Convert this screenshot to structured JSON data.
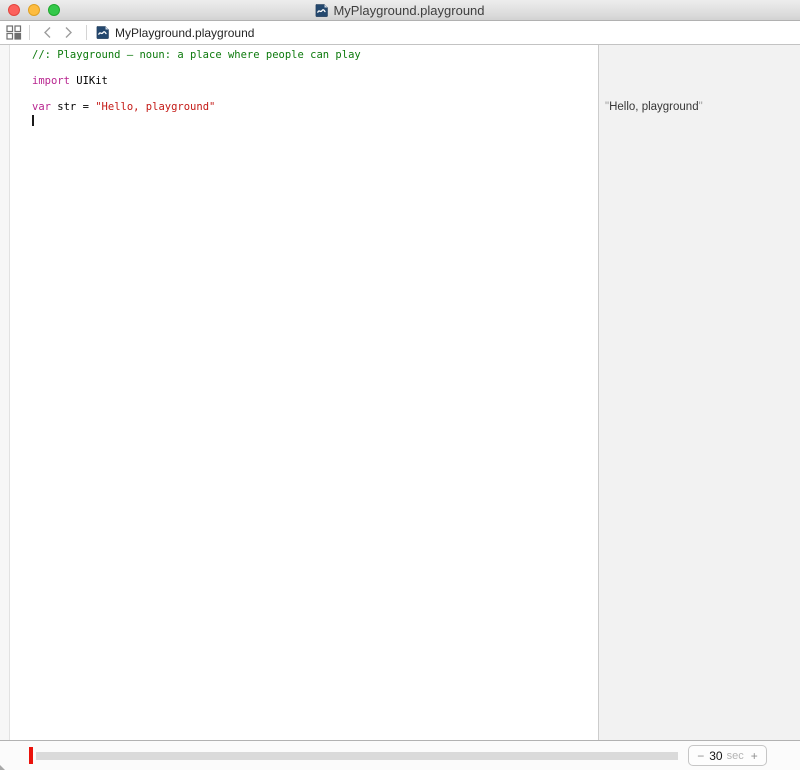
{
  "window": {
    "title": "MyPlayground.playground"
  },
  "icons": {
    "related_items": "grid-of-four-squares",
    "back": "chevron-left",
    "forward": "chevron-right",
    "file": "playground-document",
    "titlebar_file": "playground-document"
  },
  "jump_bar": {
    "file_label": "MyPlayground.playground"
  },
  "code": {
    "line1": {
      "comment": "//: Playground — noun: a place where people can play"
    },
    "line3": {
      "keyword": "import",
      "rest": " UIKit"
    },
    "line5": {
      "keyword": "var",
      "mid": " str = ",
      "string": "\"Hello, playground\""
    }
  },
  "results": {
    "item": {
      "open_quote": "\"",
      "text": "Hello, playground",
      "close_quote": "\""
    }
  },
  "bottom_bar": {
    "duration_control": {
      "minus": "−",
      "value": "30",
      "unit": "sec",
      "plus": "+"
    }
  },
  "colors": {
    "comment_green": "#0d7a0d",
    "keyword_pink": "#b8258f",
    "string_red": "#c41a16",
    "timeline_marker_red": "#ea120b",
    "results_background": "#f2f2f2"
  }
}
